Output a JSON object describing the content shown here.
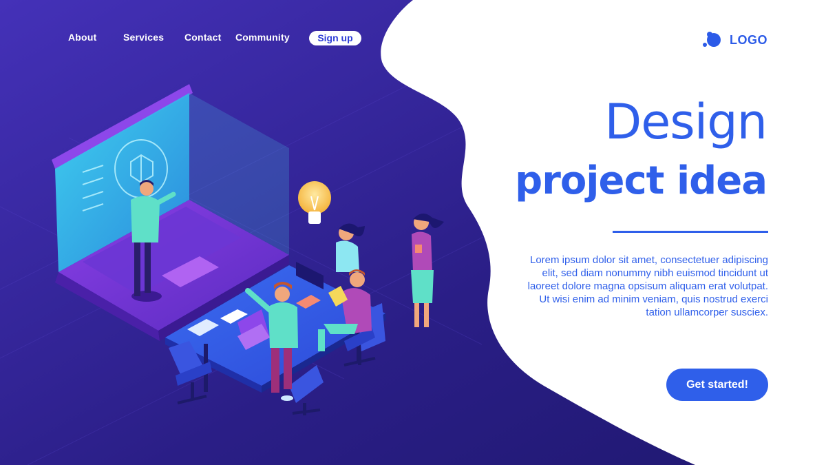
{
  "nav": {
    "about": "About",
    "services": "Services",
    "contact": "Contact",
    "community": "Community",
    "signup": "Sign up"
  },
  "logo": {
    "text": "LOGO"
  },
  "hero": {
    "title_line1": "Design",
    "title_line2": "project idea",
    "body": "Lorem ipsum dolor sit amet, consectetuer adipiscing elit, sed diam nonummy nibh euismod tincidunt ut laoreet dolore magna opsisum aliquam erat volutpat. Ut wisi enim ad minim veniam, quis nostrud exerci tation ullamcorper susciex.",
    "cta": "Get started!"
  },
  "colors": {
    "background_dark": "#2a1f88",
    "accent_blue": "#2f5fea",
    "panel_white": "#ffffff"
  }
}
